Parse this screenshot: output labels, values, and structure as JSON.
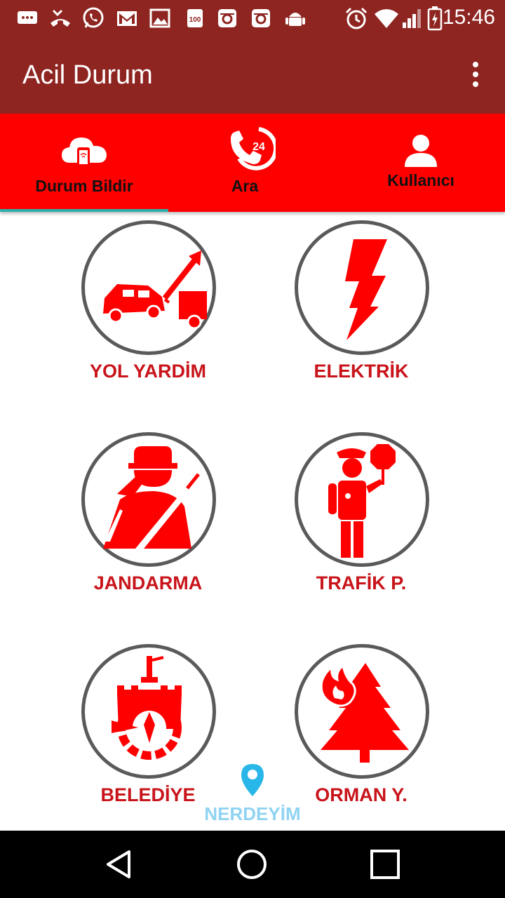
{
  "status_bar": {
    "time": "15:46",
    "icons": [
      "message-icon",
      "missed-call-icon",
      "whatsapp-icon",
      "gmail-icon",
      "gallery-icon",
      "battery-100-icon",
      "instagram-icon",
      "instagram-icon",
      "android-icon",
      "alarm-icon",
      "wifi-icon",
      "signal-icon",
      "battery-charging-icon"
    ]
  },
  "app_bar": {
    "title": "Acil Durum"
  },
  "tabs": [
    {
      "label": "Durum Bildir",
      "icon": "cloud-phone-icon",
      "selected": true
    },
    {
      "label": "Ara",
      "icon": "phone-24-icon",
      "selected": false
    },
    {
      "label": "Kullanıcı",
      "icon": "user-icon",
      "selected": false
    }
  ],
  "services": [
    {
      "label": "YOL YARDİM",
      "icon": "tow-truck-icon"
    },
    {
      "label": "ELEKTRİK",
      "icon": "lightning-icon"
    },
    {
      "label": "JANDARMA",
      "icon": "gendarme-icon"
    },
    {
      "label": "TRAFİK P.",
      "icon": "traffic-police-icon"
    },
    {
      "label": "BELEDİYE",
      "icon": "municipality-icon"
    },
    {
      "label": "ORMAN Y.",
      "icon": "forest-fire-icon"
    }
  ],
  "location_button": {
    "label": "NERDEYİM",
    "icon": "location-pin-icon"
  },
  "colors": {
    "app_bar": "#8e2521",
    "tab_bar": "#ff0000",
    "label": "#c8141a",
    "indicator": "#2ab0a8",
    "location": "#8fd3f2"
  }
}
